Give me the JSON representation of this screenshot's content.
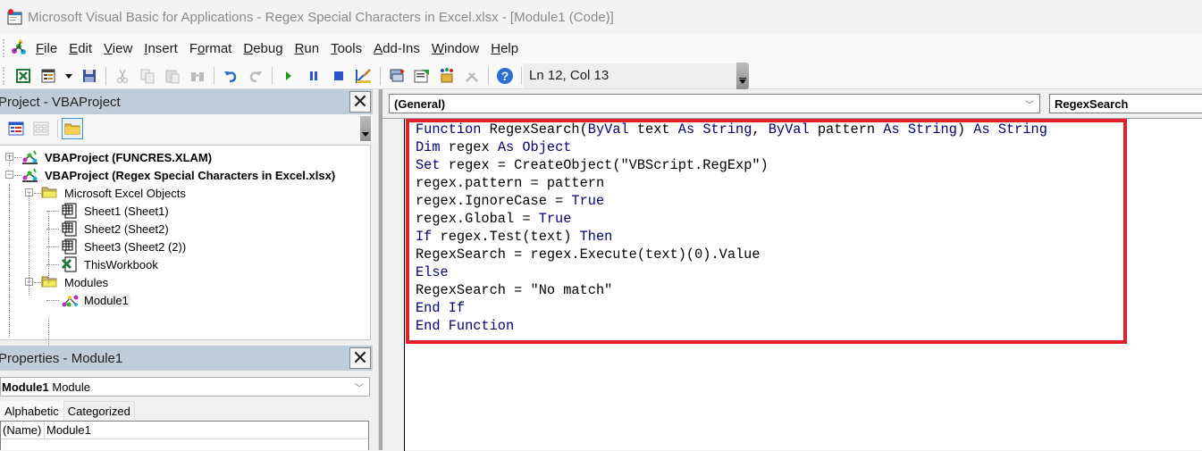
{
  "window": {
    "title": "Microsoft Visual Basic for Applications - Regex Special Characters in Excel.xlsx - [Module1 (Code)]"
  },
  "menu": {
    "items": [
      {
        "label": "File",
        "accel": "F",
        "rest": "ile"
      },
      {
        "label": "Edit",
        "accel": "E",
        "rest": "dit"
      },
      {
        "label": "View",
        "accel": "V",
        "rest": "iew"
      },
      {
        "label": "Insert",
        "accel": "I",
        "rest": "nsert"
      },
      {
        "label": "Format",
        "accel_pre": "F",
        "accel": "o",
        "rest": "rmat"
      },
      {
        "label": "Debug",
        "accel": "D",
        "rest": "ebug"
      },
      {
        "label": "Run",
        "accel": "R",
        "rest": "un"
      },
      {
        "label": "Tools",
        "accel": "T",
        "rest": "ools"
      },
      {
        "label": "Add-Ins",
        "accel": "A",
        "rest": "dd-Ins"
      },
      {
        "label": "Window",
        "accel": "W",
        "rest": "indow"
      },
      {
        "label": "Help",
        "accel": "H",
        "rest": "elp"
      }
    ]
  },
  "toolbar": {
    "buttons": [
      "view-excel-icon",
      "insert-userform-icon",
      "dropdown-arrow-icon",
      "save-icon",
      "cut-icon",
      "copy-icon",
      "paste-icon",
      "find-icon",
      "undo-icon",
      "redo-icon",
      "run-icon",
      "break-icon",
      "reset-icon",
      "design-mode-icon",
      "project-explorer-icon",
      "properties-window-icon",
      "object-browser-icon",
      "toolbox-icon",
      "help-icon"
    ],
    "cursor_position": "Ln 12, Col 13"
  },
  "project_panel": {
    "title": "Project - VBAProject",
    "tree": [
      {
        "label": "VBAProject (FUNCRES.XLAM)",
        "level": 0,
        "expander": "+",
        "icon": "vba-project-icon",
        "bold": true
      },
      {
        "label": "VBAProject (Regex Special Characters in Excel.xlsx)",
        "level": 0,
        "expander": "-",
        "icon": "vba-project-icon",
        "bold": true
      },
      {
        "label": "Microsoft Excel Objects",
        "level": 1,
        "expander": "-",
        "icon": "folder-icon",
        "bold": false
      },
      {
        "label": "Sheet1 (Sheet1)",
        "level": 2,
        "icon": "worksheet-icon",
        "bold": false
      },
      {
        "label": "Sheet2 (Sheet2)",
        "level": 2,
        "icon": "worksheet-icon",
        "bold": false
      },
      {
        "label": "Sheet3 (Sheet2 (2))",
        "level": 2,
        "icon": "worksheet-icon",
        "bold": false
      },
      {
        "label": "ThisWorkbook",
        "level": 2,
        "icon": "workbook-icon",
        "bold": false
      },
      {
        "label": "Modules",
        "level": 1,
        "expander": "-",
        "icon": "folder-icon",
        "bold": false
      },
      {
        "label": "Module1",
        "level": 2,
        "icon": "module-icon",
        "bold": false,
        "selected": true
      }
    ]
  },
  "properties_panel": {
    "title": "Properties - Module1",
    "object_name": "Module1",
    "object_type": "Module",
    "tabs": [
      "Alphabetic",
      "Categorized"
    ],
    "active_tab": "Alphabetic",
    "rows": [
      {
        "name": "(Name)",
        "value": "Module1"
      }
    ]
  },
  "code_window": {
    "object_combo": "(General)",
    "procedure_combo": "RegexSearch",
    "highlight_color": "#e3202a",
    "keyword_color": "#00007f",
    "lines": [
      [
        {
          "t": "Function",
          "k": 1
        },
        {
          "t": " RegexSearch("
        },
        {
          "t": "ByVal",
          "k": 1
        },
        {
          "t": " text "
        },
        {
          "t": "As",
          "k": 1
        },
        {
          "t": " "
        },
        {
          "t": "String",
          "k": 1
        },
        {
          "t": ", "
        },
        {
          "t": "ByVal",
          "k": 1
        },
        {
          "t": " pattern "
        },
        {
          "t": "As",
          "k": 1
        },
        {
          "t": " "
        },
        {
          "t": "String",
          "k": 1
        },
        {
          "t": ") "
        },
        {
          "t": "As",
          "k": 1
        },
        {
          "t": " "
        },
        {
          "t": "String",
          "k": 1
        }
      ],
      [
        {
          "t": "Dim",
          "k": 1
        },
        {
          "t": " regex "
        },
        {
          "t": "As",
          "k": 1
        },
        {
          "t": " "
        },
        {
          "t": "Object",
          "k": 1
        }
      ],
      [
        {
          "t": "Set",
          "k": 1
        },
        {
          "t": " regex = CreateObject(\"VBScript.RegExp\")"
        }
      ],
      [
        {
          "t": "regex.pattern = pattern"
        }
      ],
      [
        {
          "t": "regex.IgnoreCase = "
        },
        {
          "t": "True",
          "k": 1
        }
      ],
      [
        {
          "t": "regex.Global = "
        },
        {
          "t": "True",
          "k": 1
        }
      ],
      [
        {
          "t": "If",
          "k": 1
        },
        {
          "t": " regex.Test(text) "
        },
        {
          "t": "Then",
          "k": 1
        }
      ],
      [
        {
          "t": "RegexSearch = regex.Execute(text)(0).Value"
        }
      ],
      [
        {
          "t": "Else",
          "k": 1
        }
      ],
      [
        {
          "t": "RegexSearch = \"No match\""
        }
      ],
      [
        {
          "t": "End",
          "k": 1
        },
        {
          "t": " "
        },
        {
          "t": "If",
          "k": 1
        }
      ],
      [
        {
          "t": "End",
          "k": 1
        },
        {
          "t": " "
        },
        {
          "t": "Function",
          "k": 1
        }
      ]
    ]
  }
}
